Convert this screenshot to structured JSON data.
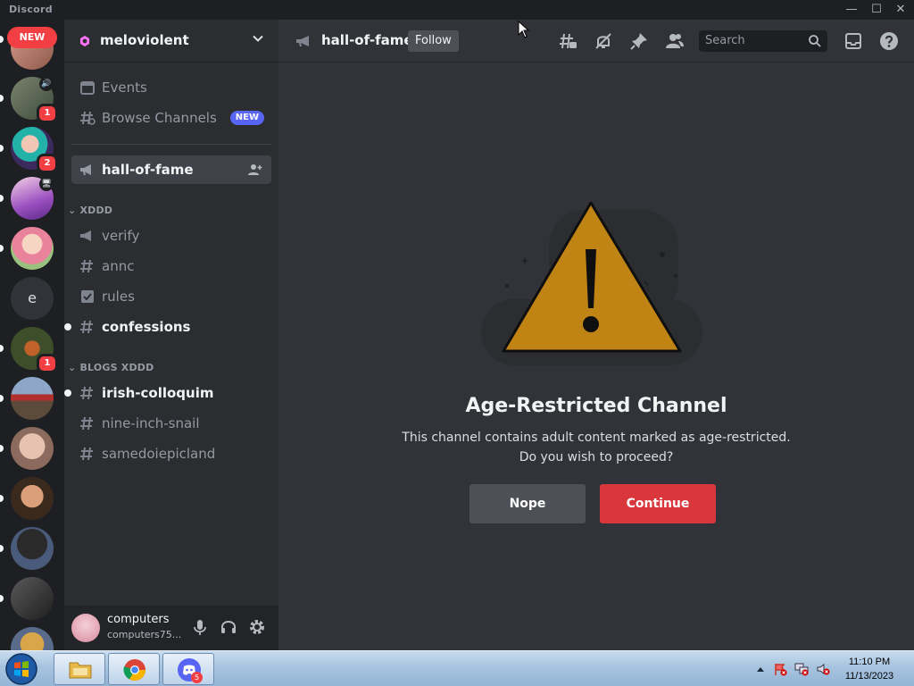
{
  "app": {
    "title": "Discord"
  },
  "window_controls": {
    "minimize": "—",
    "maximize": "☐",
    "close": "✕"
  },
  "rail": {
    "new_label": "NEW",
    "servers": [
      {
        "id": "s1",
        "badge": "1",
        "sub": "🔊"
      },
      {
        "id": "s2",
        "badge": "2"
      },
      {
        "id": "s3",
        "sub": "🖥"
      },
      {
        "id": "s4"
      },
      {
        "id": "s5",
        "letter": "e"
      },
      {
        "id": "s6",
        "badge": "1"
      },
      {
        "id": "s7"
      },
      {
        "id": "s8"
      },
      {
        "id": "s9"
      },
      {
        "id": "s10"
      },
      {
        "id": "s11"
      },
      {
        "id": "s12"
      }
    ]
  },
  "guild": {
    "name": "meloviolent"
  },
  "sidebar": {
    "events_label": "Events",
    "browse_label": "Browse Channels",
    "browse_tag": "NEW",
    "active_channel": "hall-of-fame",
    "categories": [
      {
        "name": "XDDD",
        "channels": [
          "verify",
          "annc",
          "rules",
          "confessions"
        ]
      },
      {
        "name": "BLOGS XDDD",
        "channels": [
          "irish-colloquim",
          "nine-inch-snail",
          "samedoiepicland"
        ]
      }
    ]
  },
  "user": {
    "name": "computers",
    "tag": "computers75..."
  },
  "header": {
    "channel": "hall-of-fame",
    "follow_label": "Follow",
    "search_placeholder": "Search"
  },
  "gate": {
    "title": "Age-Restricted Channel",
    "line1": "This channel contains adult content marked as age-restricted.",
    "line2": "Do you wish to proceed?",
    "nope_label": "Nope",
    "continue_label": "Continue"
  },
  "taskbar": {
    "time": "11:10 PM",
    "date": "11/13/2023",
    "discord_badge": "5"
  },
  "colors": {
    "accent_red": "#da373c",
    "warning": "#c08414",
    "blurple": "#5865f2"
  }
}
